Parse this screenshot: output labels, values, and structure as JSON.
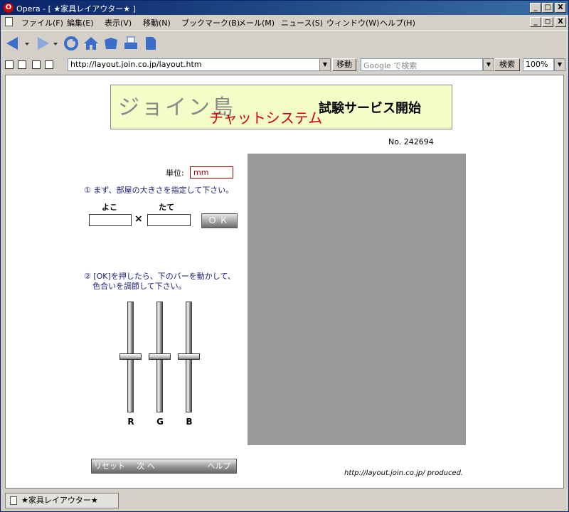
{
  "window": {
    "title": "Opera - [ ★家具レイアウター★ ]",
    "logo_letter": "O",
    "controls": {
      "minimize": "_",
      "maximize": "□",
      "close": "X",
      "restore": "◻"
    }
  },
  "menu": {
    "items": [
      "ファイル(F)",
      "編集(E)",
      "表示(V)",
      "移動(N)",
      "ブックマーク(B)",
      "メール(M)",
      "ニュース(S)",
      "ウィンドウ(W)",
      "ヘルプ(H)"
    ]
  },
  "toolbar": {
    "icons": [
      "back-icon",
      "forward-icon",
      "reload-icon",
      "home-icon",
      "hotlist-icon",
      "print-icon",
      "page-icon"
    ]
  },
  "address_bar": {
    "url": "http://layout.join.co.jp/layout.htm",
    "go_label": "移動",
    "search_placeholder": "Google で検索",
    "search_label": "検索",
    "zoom": "100%"
  },
  "banner": {
    "title": "ジョイン島",
    "subtitle": "チャットシステム",
    "headline": "試験サービス開始"
  },
  "counter": "No. 242694",
  "form": {
    "unit_label": "単位:",
    "unit_value": "mm",
    "step1": "① まず、部屋の大きさを指定して下さい。",
    "width_label": "よこ",
    "height_label": "たて",
    "times_symbol": "×",
    "ok_label": "ＯＫ",
    "step2_line1": "② [OK]を押したら、下のバーを動かして、",
    "step2_line2": "色合いを調節して下さい。"
  },
  "sliders": [
    {
      "label": "R",
      "level": 0.5
    },
    {
      "label": "G",
      "level": 0.5
    },
    {
      "label": "B",
      "level": 0.5
    }
  ],
  "preview": {
    "color": "#999999"
  },
  "buttons": {
    "reset": "リセット",
    "next": "次 へ",
    "help": "ヘルプ"
  },
  "footer": {
    "produced": "http://layout.join.co.jp/  produced."
  },
  "status": {
    "tab_title": "★家具レイアウター★"
  },
  "colors": {
    "title_bar": "#0a246a",
    "banner_bg": "#f4fcc8",
    "banner_sub": "#d40000",
    "instruction_text": "#1a1a7a",
    "unit_border": "#8b0000"
  }
}
